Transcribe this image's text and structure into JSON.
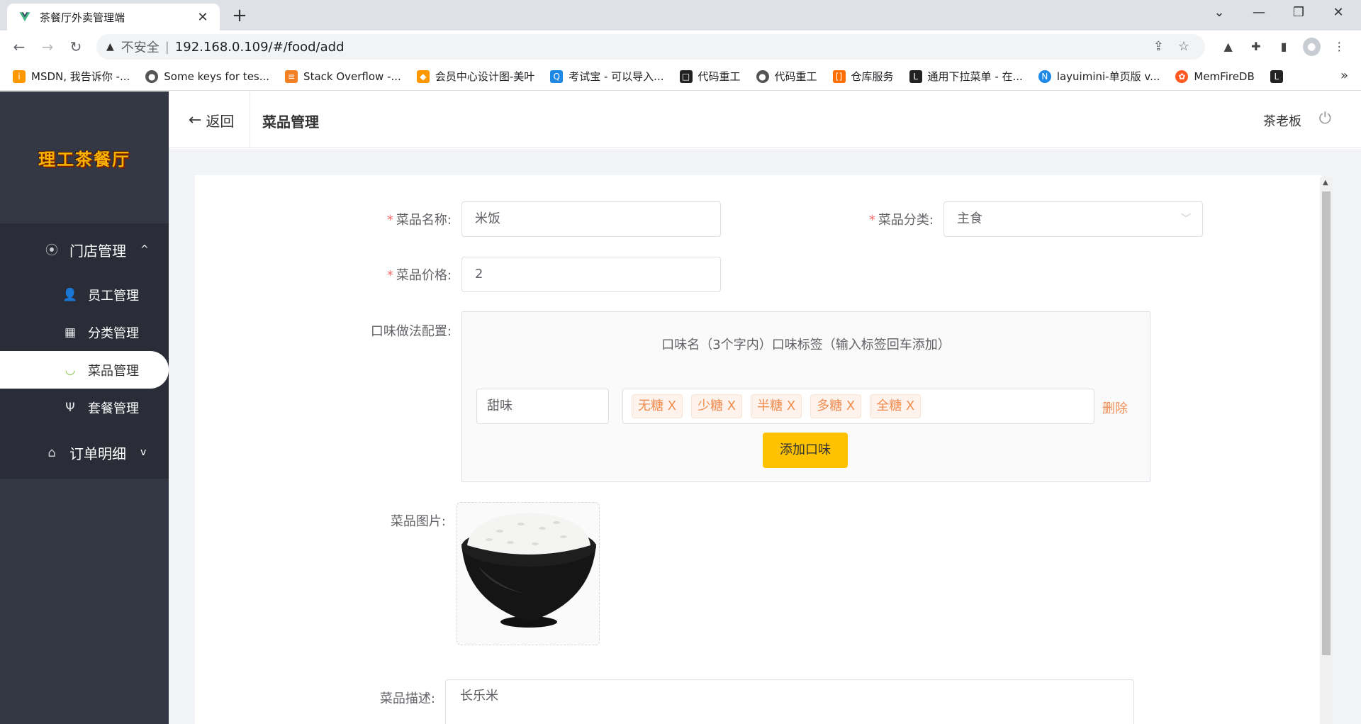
{
  "browser": {
    "tab_title": "茶餐厅外卖管理端",
    "tab_close": "✕",
    "new_tab": "+",
    "insecure_label": "不安全",
    "separator": "|",
    "url": "192.168.0.109/#/food/add",
    "bookmarks": [
      {
        "label": "MSDN, 我告诉你 -...",
        "color": "#ff9800"
      },
      {
        "label": "Some keys for tes...",
        "color": "#555555"
      },
      {
        "label": "Stack Overflow -...",
        "color": "#f48024"
      },
      {
        "label": "会员中心设计图-美叶",
        "color": "#ff9800"
      },
      {
        "label": "考试宝 - 可以导入...",
        "color": "#1e88e5"
      },
      {
        "label": "代码重工",
        "color": "#222222"
      },
      {
        "label": "代码重工",
        "color": "#555555"
      },
      {
        "label": "仓库服务",
        "color": "#ff6d00"
      },
      {
        "label": "通用下拉菜单 - 在...",
        "color": "#222222"
      },
      {
        "label": "layuimini-单页版 v...",
        "color": "#1e88e5"
      },
      {
        "label": "MemFireDB",
        "color": "#ff5722"
      }
    ],
    "bookmarks_more": "»"
  },
  "sidebar": {
    "logo_text": "理工茶餐厅",
    "groups": [
      {
        "label": "门店管理",
        "arrow": "^"
      },
      {
        "label": "订单明细",
        "arrow": "v"
      }
    ],
    "items": [
      {
        "label": "员工管理"
      },
      {
        "label": "分类管理"
      },
      {
        "label": "菜品管理"
      },
      {
        "label": "套餐管理"
      }
    ]
  },
  "header": {
    "back_label": "返回",
    "title": "菜品管理",
    "user_name": "茶老板"
  },
  "form": {
    "name_label": "菜品名称:",
    "name_value": "米饭",
    "category_label": "菜品分类:",
    "category_value": "主食",
    "price_label": "菜品价格:",
    "price_value": "2",
    "flavor_label": "口味做法配置:",
    "flavor_header": "口味名（3个字内）口味标签（输入标签回车添加）",
    "flavor_name": "甜味",
    "flavor_tags": [
      "无糖 X",
      "少糖 X",
      "半糖 X",
      "多糖 X",
      "全糖 X"
    ],
    "delete_label": "删除",
    "add_flavor_label": "添加口味",
    "image_label": "菜品图片:",
    "desc_label": "菜品描述:",
    "desc_value": "长乐米"
  },
  "colors": {
    "sidebar_bg": "#343744",
    "accent": "#ffc200",
    "tag_text": "#f08c4f",
    "required": "#f56c6c"
  }
}
